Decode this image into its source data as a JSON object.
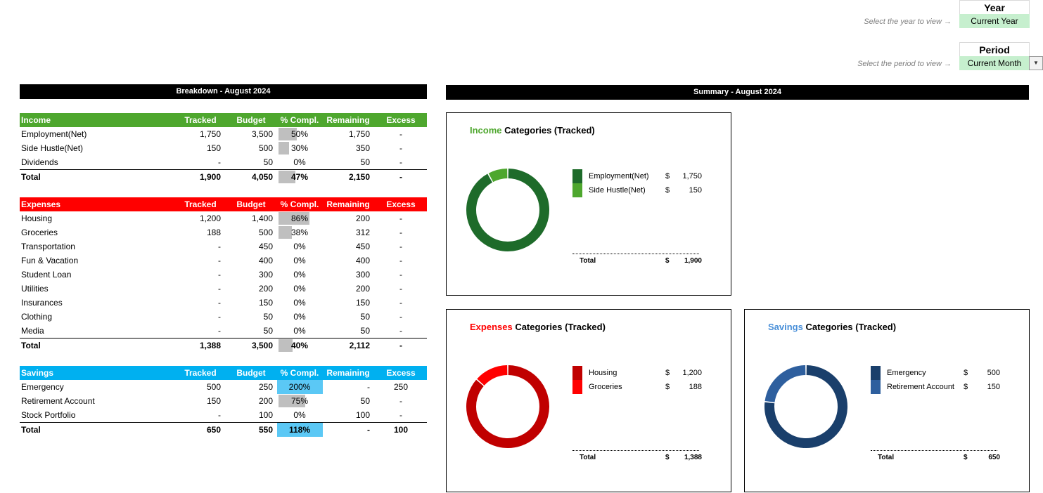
{
  "selectors": {
    "year": {
      "hint": "Select the year to view →",
      "label": "Year",
      "value": "Current Year"
    },
    "period": {
      "hint": "Select the period to view →",
      "label": "Period",
      "value": "Current Month"
    }
  },
  "breakdown_title": "Breakdown - August 2024",
  "summary_title": "Summary - August 2024",
  "columns": {
    "tracked": "Tracked",
    "budget": "Budget",
    "pct": "% Compl.",
    "remaining": "Remaining",
    "excess": "Excess"
  },
  "colors": {
    "income": "#4ea72e",
    "expenses": "#ff0000",
    "savings": "#00b0f0"
  },
  "income": {
    "label": "Income",
    "rows": [
      {
        "name": "Employment(Net)",
        "tracked": "1,750",
        "budget": "3,500",
        "pct": "50%",
        "remaining": "1,750",
        "excess": "-",
        "fill": 0.5
      },
      {
        "name": "Side Hustle(Net)",
        "tracked": "150",
        "budget": "500",
        "pct": "30%",
        "remaining": "350",
        "excess": "-",
        "fill": 0.3
      },
      {
        "name": "Dividends",
        "tracked": "-",
        "budget": "50",
        "pct": "0%",
        "remaining": "50",
        "excess": "-",
        "fill": 0
      }
    ],
    "total": {
      "name": "Total",
      "tracked": "1,900",
      "budget": "4,050",
      "pct": "47%",
      "remaining": "2,150",
      "excess": "-",
      "fill": 0.47
    }
  },
  "expenses": {
    "label": "Expenses",
    "rows": [
      {
        "name": "Housing",
        "tracked": "1,200",
        "budget": "1,400",
        "pct": "86%",
        "remaining": "200",
        "excess": "-",
        "fill": 0.86
      },
      {
        "name": "Groceries",
        "tracked": "188",
        "budget": "500",
        "pct": "38%",
        "remaining": "312",
        "excess": "-",
        "fill": 0.38
      },
      {
        "name": "Transportation",
        "tracked": "-",
        "budget": "450",
        "pct": "0%",
        "remaining": "450",
        "excess": "-",
        "fill": 0
      },
      {
        "name": "Fun & Vacation",
        "tracked": "-",
        "budget": "400",
        "pct": "0%",
        "remaining": "400",
        "excess": "-",
        "fill": 0
      },
      {
        "name": "Student Loan",
        "tracked": "-",
        "budget": "300",
        "pct": "0%",
        "remaining": "300",
        "excess": "-",
        "fill": 0
      },
      {
        "name": "Utilities",
        "tracked": "-",
        "budget": "200",
        "pct": "0%",
        "remaining": "200",
        "excess": "-",
        "fill": 0
      },
      {
        "name": "Insurances",
        "tracked": "-",
        "budget": "150",
        "pct": "0%",
        "remaining": "150",
        "excess": "-",
        "fill": 0
      },
      {
        "name": "Clothing",
        "tracked": "-",
        "budget": "50",
        "pct": "0%",
        "remaining": "50",
        "excess": "-",
        "fill": 0
      },
      {
        "name": "Media",
        "tracked": "-",
        "budget": "50",
        "pct": "0%",
        "remaining": "50",
        "excess": "-",
        "fill": 0
      }
    ],
    "total": {
      "name": "Total",
      "tracked": "1,388",
      "budget": "3,500",
      "pct": "40%",
      "remaining": "2,112",
      "excess": "-",
      "fill": 0.4
    }
  },
  "savings": {
    "label": "Savings",
    "rows": [
      {
        "name": "Emergency",
        "tracked": "500",
        "budget": "250",
        "pct": "200%",
        "remaining": "-",
        "excess": "250",
        "fill": 2.0
      },
      {
        "name": "Retirement Account",
        "tracked": "150",
        "budget": "200",
        "pct": "75%",
        "remaining": "50",
        "excess": "-",
        "fill": 0.75
      },
      {
        "name": "Stock Portfolio",
        "tracked": "-",
        "budget": "100",
        "pct": "0%",
        "remaining": "100",
        "excess": "-",
        "fill": 0
      }
    ],
    "total": {
      "name": "Total",
      "tracked": "650",
      "budget": "550",
      "pct": "118%",
      "remaining": "-",
      "excess": "100",
      "fill": 1.18
    }
  },
  "chart_data": [
    {
      "type": "pie",
      "title_colored": "Income",
      "title_rest": " Categories (Tracked)",
      "title_color": "#4ea72e",
      "categories": [
        "Employment(Net)",
        "Side Hustle(Net)"
      ],
      "values": [
        1750,
        150
      ],
      "display_values": [
        "1,750",
        "150"
      ],
      "colors": [
        "#1e6b2a",
        "#4ea72e"
      ],
      "currency": "$",
      "total_label": "Total",
      "total": "1,900"
    },
    {
      "type": "pie",
      "title_colored": "Expenses",
      "title_rest": " Categories (Tracked)",
      "title_color": "#ff0000",
      "categories": [
        "Housing",
        "Groceries"
      ],
      "values": [
        1200,
        188
      ],
      "display_values": [
        "1,200",
        "188"
      ],
      "colors": [
        "#c00000",
        "#ff0000"
      ],
      "currency": "$",
      "total_label": "Total",
      "total": "1,388"
    },
    {
      "type": "pie",
      "title_colored": "Savings",
      "title_rest": " Categories (Tracked)",
      "title_color": "#4a90d9",
      "categories": [
        "Emergency",
        "Retirement Account"
      ],
      "values": [
        500,
        150
      ],
      "display_values": [
        "500",
        "150"
      ],
      "colors": [
        "#1a3f6b",
        "#2e5f9e"
      ],
      "currency": "$",
      "total_label": "Total",
      "total": "650"
    }
  ]
}
